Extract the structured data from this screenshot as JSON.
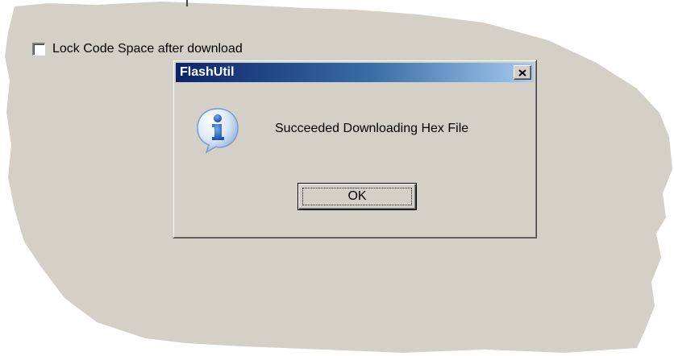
{
  "background": {
    "checkbox_label": "Lock Code Space after download",
    "checkbox_checked": false
  },
  "dialog": {
    "title": "FlashUtil",
    "message": "Succeeded Downloading Hex File",
    "ok_label": "OK",
    "icon": "info-icon",
    "close_icon": "close-icon"
  },
  "colors": {
    "window_face": "#d4d0c8",
    "title_start": "#0a246a",
    "title_end": "#a6caf0",
    "info_icon": "#2f6fc9"
  }
}
